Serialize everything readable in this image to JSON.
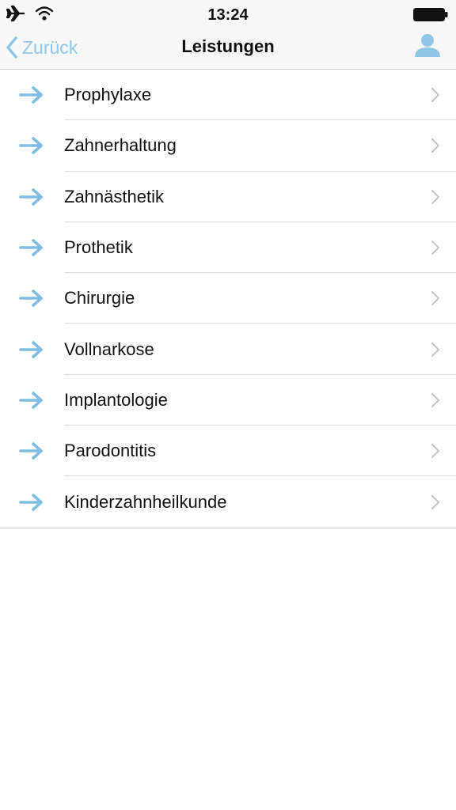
{
  "status_bar": {
    "time": "13:24",
    "icons": [
      "airplane-icon",
      "wifi-icon",
      "battery-icon"
    ]
  },
  "nav": {
    "back_label": "Zurück",
    "title": "Leistungen",
    "profile_icon": "person-icon"
  },
  "colors": {
    "accent": "#8fc6e6",
    "arrow": "#7fbde2",
    "chevron": "#c4c4c9"
  },
  "items": [
    {
      "label": "Prophylaxe"
    },
    {
      "label": "Zahnerhaltung"
    },
    {
      "label": "Zahnästhetik"
    },
    {
      "label": "Prothetik"
    },
    {
      "label": "Chirurgie"
    },
    {
      "label": "Vollnarkose"
    },
    {
      "label": "Implantologie"
    },
    {
      "label": "Parodontitis"
    },
    {
      "label": "Kinderzahnheilkunde"
    }
  ]
}
